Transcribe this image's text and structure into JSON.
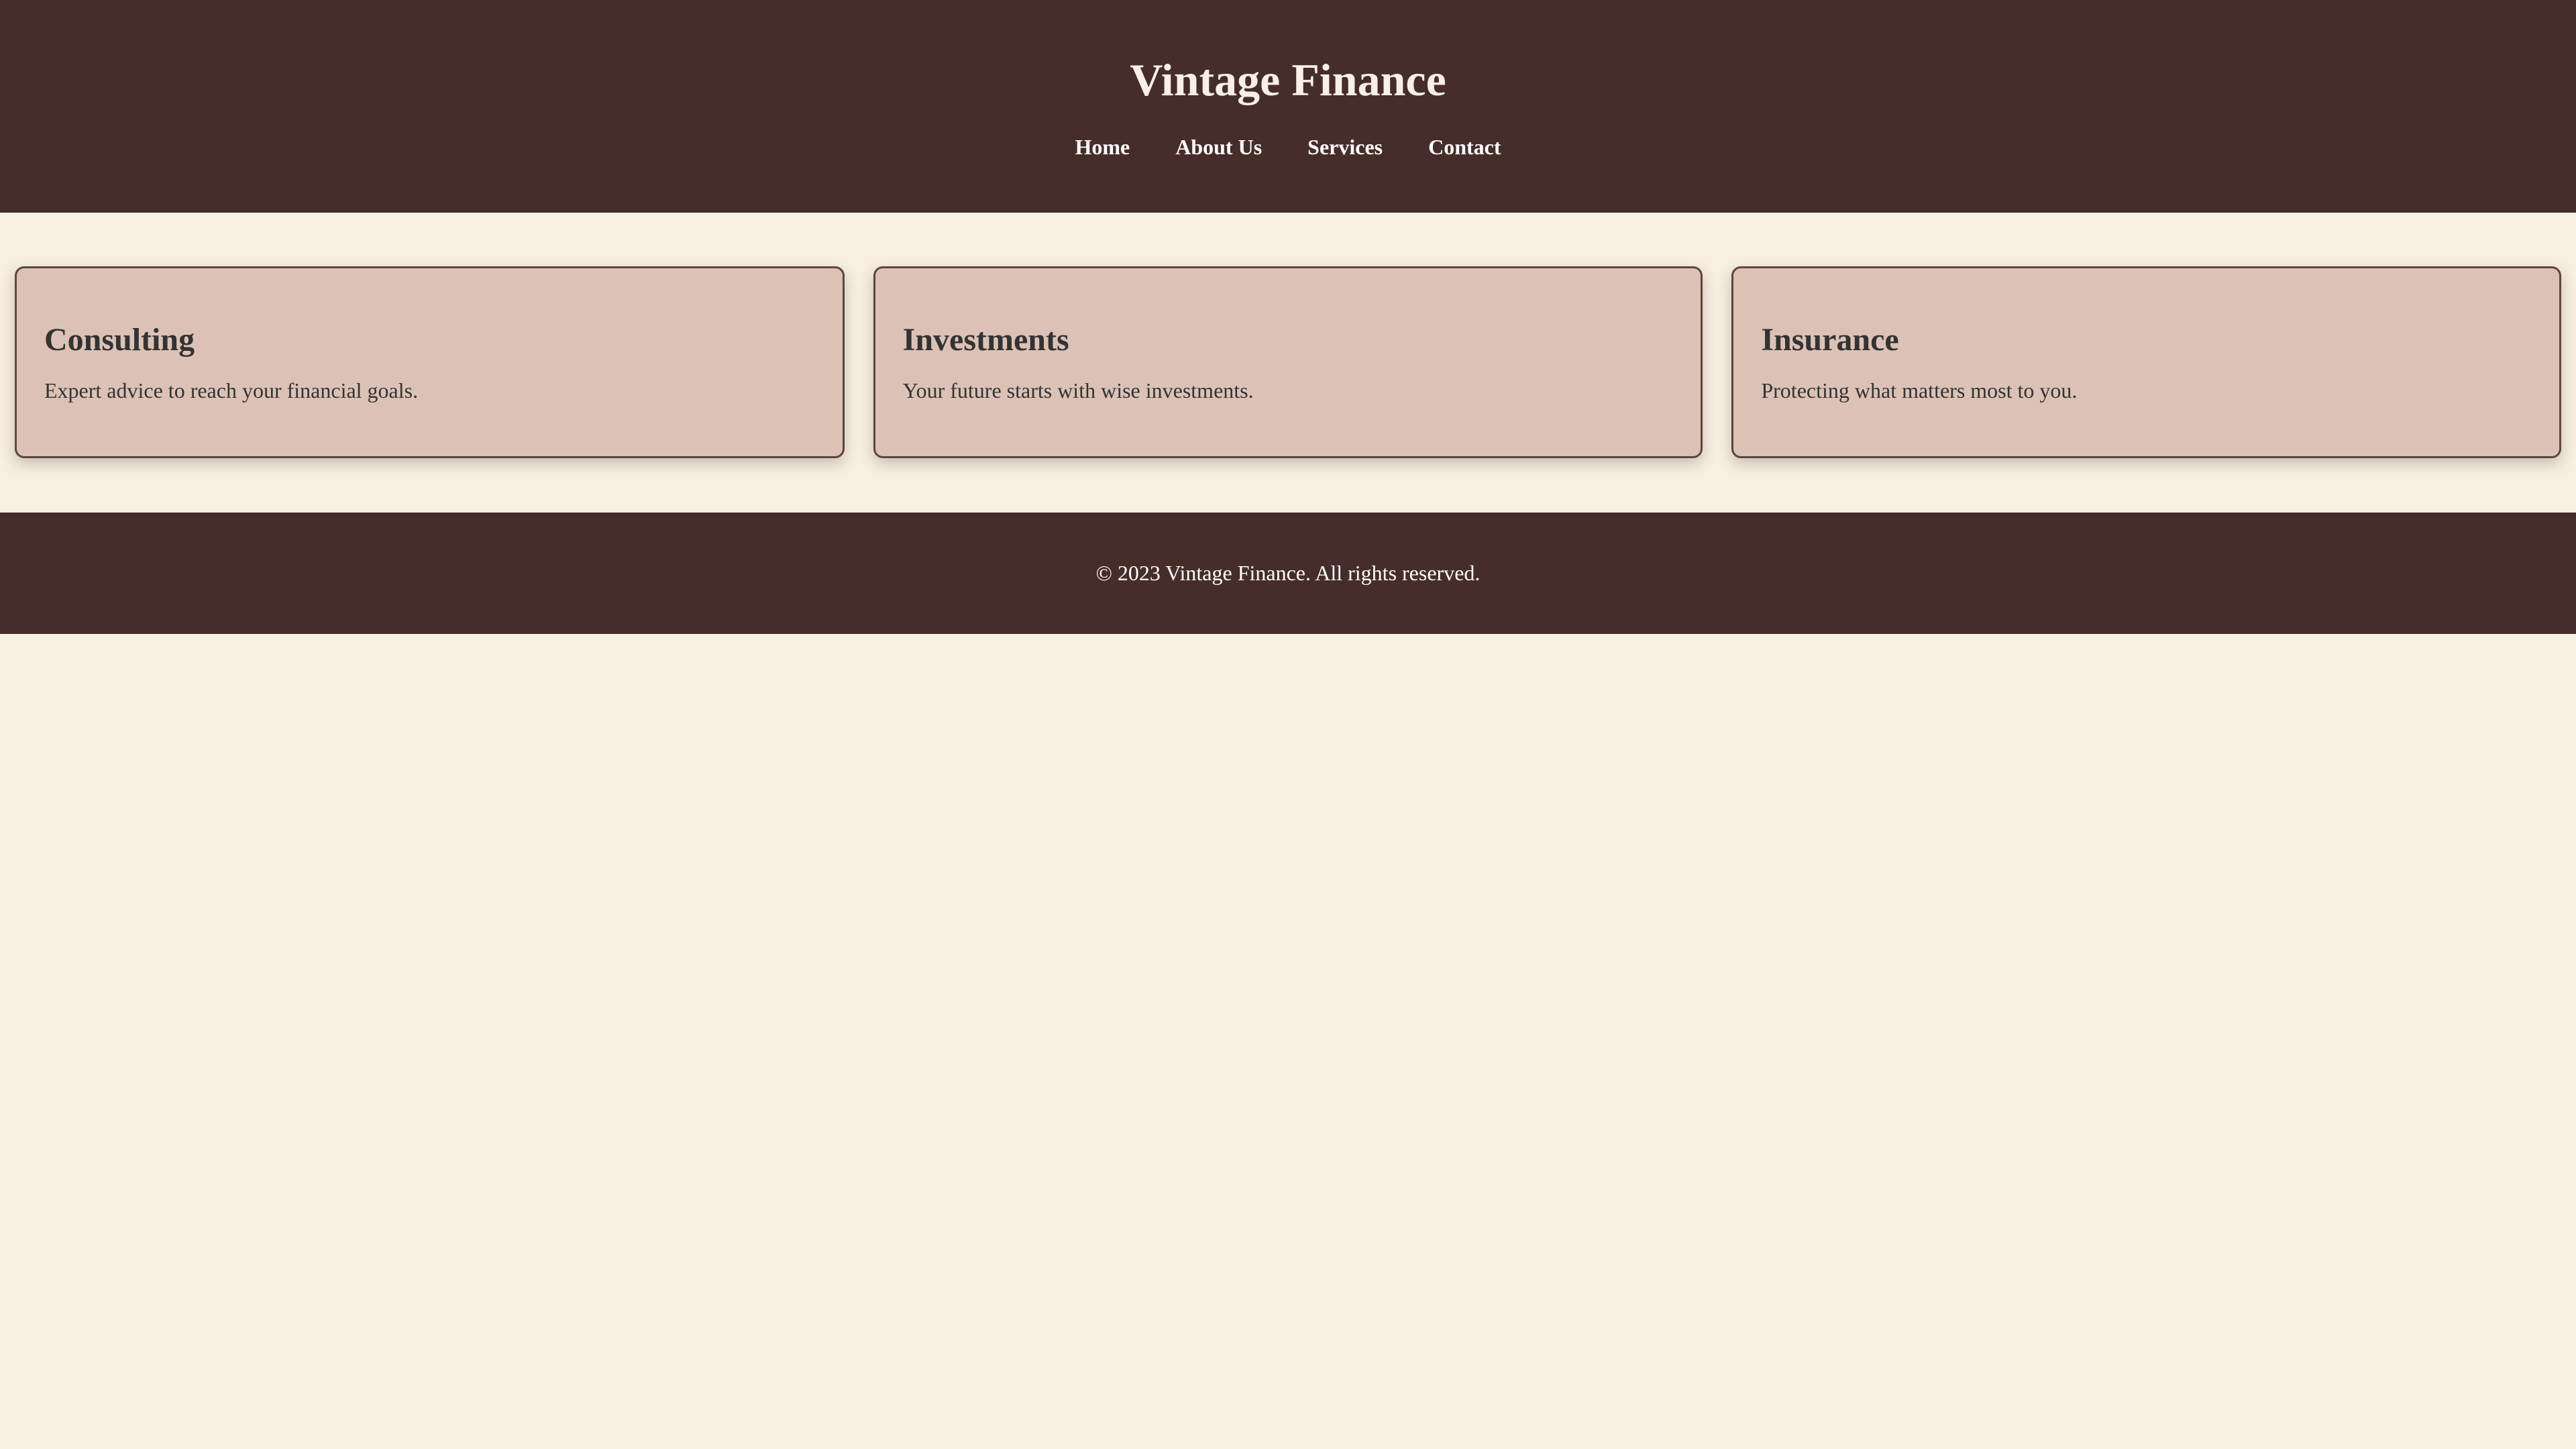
{
  "header": {
    "title": "Vintage Finance",
    "nav": [
      "Home",
      "About Us",
      "Services",
      "Contact"
    ]
  },
  "services": [
    {
      "title": "Consulting",
      "description": "Expert advice to reach your financial goals."
    },
    {
      "title": "Investments",
      "description": "Your future starts with wise investments."
    },
    {
      "title": "Insurance",
      "description": "Protecting what matters most to you."
    }
  ],
  "footer": {
    "copyright": "© 2023 Vintage Finance. All rights reserved."
  },
  "colors": {
    "header_background": "#462d2a",
    "page_background": "#f7efe2",
    "card_background": "#dcc2b6",
    "card_border": "#5d4641",
    "text": "#333333"
  }
}
